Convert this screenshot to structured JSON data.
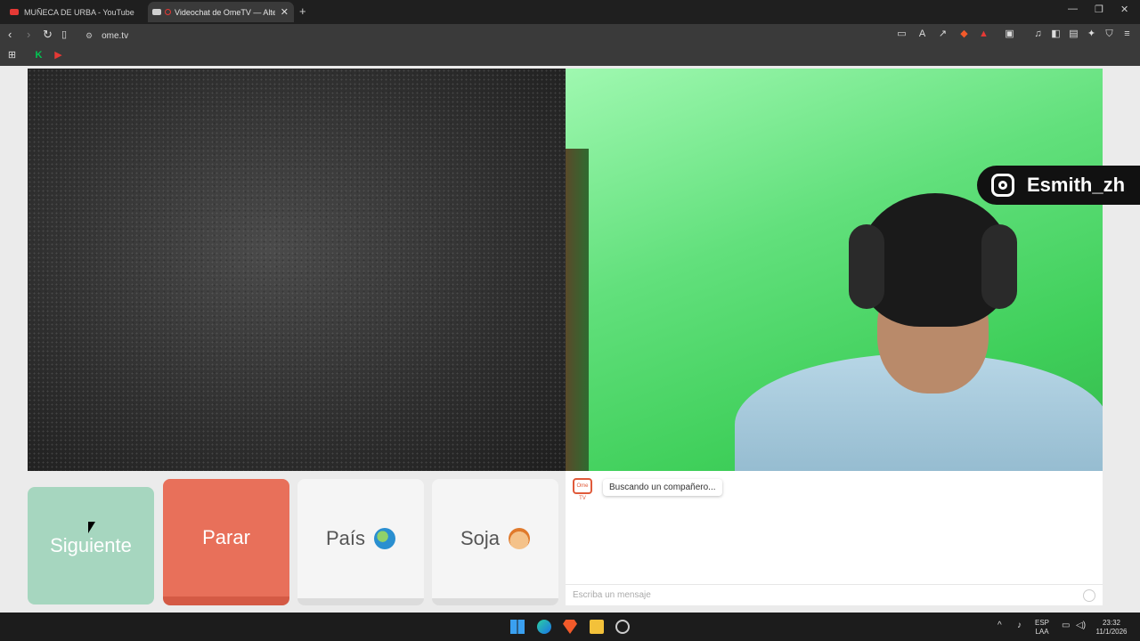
{
  "browser": {
    "tabs": [
      {
        "title": "MUÑECA DE URBA - YouTube",
        "active": false
      },
      {
        "title": "Videochat de OmeTV — Alter",
        "active": true
      }
    ],
    "address": "ome.tv"
  },
  "remote_video": {
    "instagram_handle": "Esmith_zh"
  },
  "controls": {
    "next_label": "Siguiente",
    "stop_label": "Parar",
    "country_label": "País",
    "gender_label": "Soja"
  },
  "chat": {
    "logo_text": "Ome TV",
    "status_message": "Buscando un compañero...",
    "input_placeholder": "Escriba un mensaje"
  },
  "taskbar": {
    "lang_top": "ESP",
    "lang_bottom": "LAA",
    "time": "23:32",
    "date": "11/1/2026"
  }
}
